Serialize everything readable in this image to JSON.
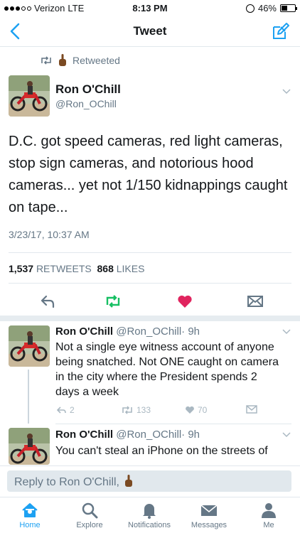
{
  "status_bar": {
    "carrier": "Verizon",
    "network": "LTE",
    "time": "8:13 PM",
    "battery": "46%",
    "battery_level": 0.46
  },
  "nav": {
    "title": "Tweet"
  },
  "retweeted_label": "Retweeted",
  "main_tweet": {
    "name": "Ron O'Chill",
    "handle": "@Ron_OChill",
    "text": "D.C. got speed cameras, red light cameras, stop sign cameras, and notorious hood cameras... yet not 1/150 kidnappings caught on tape...",
    "date": "3/23/17, 10:37 AM",
    "retweets_count": "1,537",
    "retweets_label": "RETWEETS",
    "likes_count": "868",
    "likes_label": "LIKES"
  },
  "replies": [
    {
      "name": "Ron O'Chill",
      "handle": "@Ron_OChill",
      "age": "· 9h",
      "text": "Not a single eye witness account of anyone being snatched. Not ONE caught on camera in the city where the President spends 2 days a week",
      "reply_count": "2",
      "retweet_count": "133",
      "like_count": "70"
    },
    {
      "name": "Ron O'Chill",
      "handle": "@Ron_OChill",
      "age": "· 9h",
      "text": "You can't steal an iPhone on the streets of"
    }
  ],
  "reply_bar": {
    "placeholder": "Reply to Ron O'Chill,"
  },
  "tabs": [
    {
      "label": "Home",
      "icon": "home-icon"
    },
    {
      "label": "Explore",
      "icon": "search-icon"
    },
    {
      "label": "Notifications",
      "icon": "bell-icon"
    },
    {
      "label": "Messages",
      "icon": "envelope-icon"
    },
    {
      "label": "Me",
      "icon": "person-icon"
    }
  ],
  "colors": {
    "accent": "#1da1f2",
    "retweet_green": "#17bf63",
    "like_red": "#e0245e",
    "muted": "#657786"
  }
}
